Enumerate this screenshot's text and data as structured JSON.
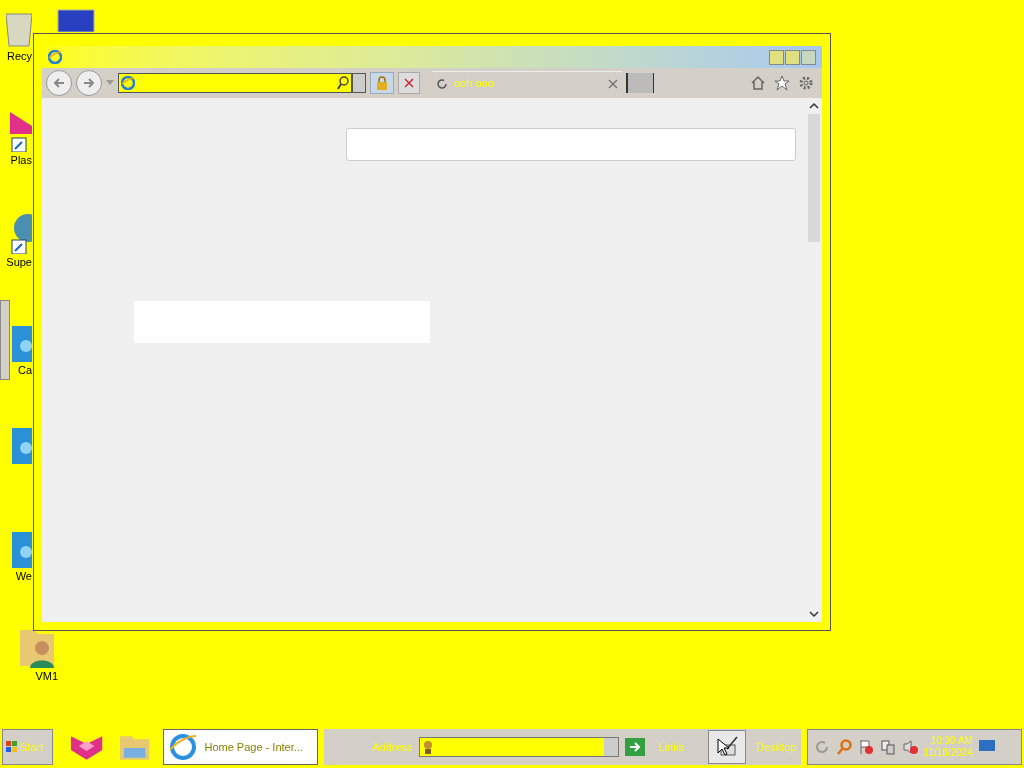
{
  "desktop_icons": [
    {
      "label": "Recy",
      "kind": "bin"
    },
    {
      "kind": "monitor"
    },
    {
      "label": "Plas",
      "kind": "app"
    },
    {
      "label": "Supe",
      "kind": "app2"
    },
    {
      "label": "Ca",
      "kind": "image"
    },
    {
      "kind": "image"
    },
    {
      "label": "We",
      "kind": "image"
    },
    {
      "label": "VM1",
      "kind": "folder"
    }
  ],
  "browser": {
    "tab": {
      "title": "ooh ooo"
    }
  },
  "taskbar": {
    "start": "Start",
    "task": {
      "label": "Home Page - Inter...",
      "selected": true
    },
    "address_label": "Address",
    "links": "Links",
    "desktop": "Desktop",
    "time": "10:30 AM",
    "date": "11/18/2024"
  }
}
